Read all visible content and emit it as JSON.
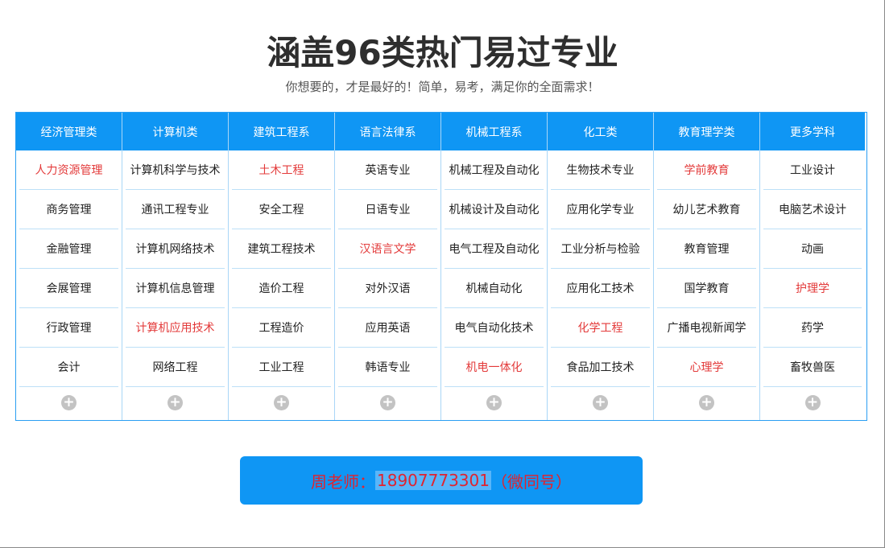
{
  "title": "涵盖96类热门易过专业",
  "subtitle": "你想要的，才是最好的！简单，易考，满足你的全面需求！",
  "columns": [
    {
      "header": "经济管理类",
      "items": [
        {
          "label": "人力资源管理",
          "highlight": true
        },
        {
          "label": "商务管理",
          "highlight": false
        },
        {
          "label": "金融管理",
          "highlight": false
        },
        {
          "label": "会展管理",
          "highlight": false
        },
        {
          "label": "行政管理",
          "highlight": false
        },
        {
          "label": "会计",
          "highlight": false
        }
      ]
    },
    {
      "header": "计算机类",
      "items": [
        {
          "label": "计算机科学与技术",
          "highlight": false
        },
        {
          "label": "通讯工程专业",
          "highlight": false
        },
        {
          "label": "计算机网络技术",
          "highlight": false
        },
        {
          "label": "计算机信息管理",
          "highlight": false
        },
        {
          "label": "计算机应用技术",
          "highlight": true
        },
        {
          "label": "网络工程",
          "highlight": false
        }
      ]
    },
    {
      "header": "建筑工程系",
      "items": [
        {
          "label": "土木工程",
          "highlight": true
        },
        {
          "label": "安全工程",
          "highlight": false
        },
        {
          "label": "建筑工程技术",
          "highlight": false
        },
        {
          "label": "造价工程",
          "highlight": false
        },
        {
          "label": "工程造价",
          "highlight": false
        },
        {
          "label": "工业工程",
          "highlight": false
        }
      ]
    },
    {
      "header": "语言法律系",
      "items": [
        {
          "label": "英语专业",
          "highlight": false
        },
        {
          "label": "日语专业",
          "highlight": false
        },
        {
          "label": "汉语言文学",
          "highlight": true
        },
        {
          "label": "对外汉语",
          "highlight": false
        },
        {
          "label": "应用英语",
          "highlight": false
        },
        {
          "label": "韩语专业",
          "highlight": false
        }
      ]
    },
    {
      "header": "机械工程系",
      "items": [
        {
          "label": "机械工程及自动化",
          "highlight": false
        },
        {
          "label": "机械设计及自动化",
          "highlight": false
        },
        {
          "label": "电气工程及自动化",
          "highlight": false
        },
        {
          "label": "机械自动化",
          "highlight": false
        },
        {
          "label": "电气自动化技术",
          "highlight": false
        },
        {
          "label": "机电一体化",
          "highlight": true
        }
      ]
    },
    {
      "header": "化工类",
      "items": [
        {
          "label": "生物技术专业",
          "highlight": false
        },
        {
          "label": "应用化学专业",
          "highlight": false
        },
        {
          "label": "工业分析与检验",
          "highlight": false
        },
        {
          "label": "应用化工技术",
          "highlight": false
        },
        {
          "label": "化学工程",
          "highlight": true
        },
        {
          "label": "食品加工技术",
          "highlight": false
        }
      ]
    },
    {
      "header": "教育理学类",
      "items": [
        {
          "label": "学前教育",
          "highlight": true
        },
        {
          "label": "幼儿艺术教育",
          "highlight": false
        },
        {
          "label": "教育管理",
          "highlight": false
        },
        {
          "label": "国学教育",
          "highlight": false
        },
        {
          "label": "广播电视新闻学",
          "highlight": false
        },
        {
          "label": "心理学",
          "highlight": true
        }
      ]
    },
    {
      "header": "更多学科",
      "items": [
        {
          "label": "工业设计",
          "highlight": false
        },
        {
          "label": "电脑艺术设计",
          "highlight": false
        },
        {
          "label": "动画",
          "highlight": false
        },
        {
          "label": "护理学",
          "highlight": true
        },
        {
          "label": "药学",
          "highlight": false
        },
        {
          "label": "畜牧兽医",
          "highlight": false
        }
      ]
    }
  ],
  "more_icon": "plus-icon",
  "contact": {
    "prefix": "周老师：",
    "phone": "18907773301",
    "suffix": "（微同号）"
  },
  "colors": {
    "accent": "#0f96f4",
    "highlight_text": "#e33a3a",
    "contact_text": "#e0232f"
  }
}
